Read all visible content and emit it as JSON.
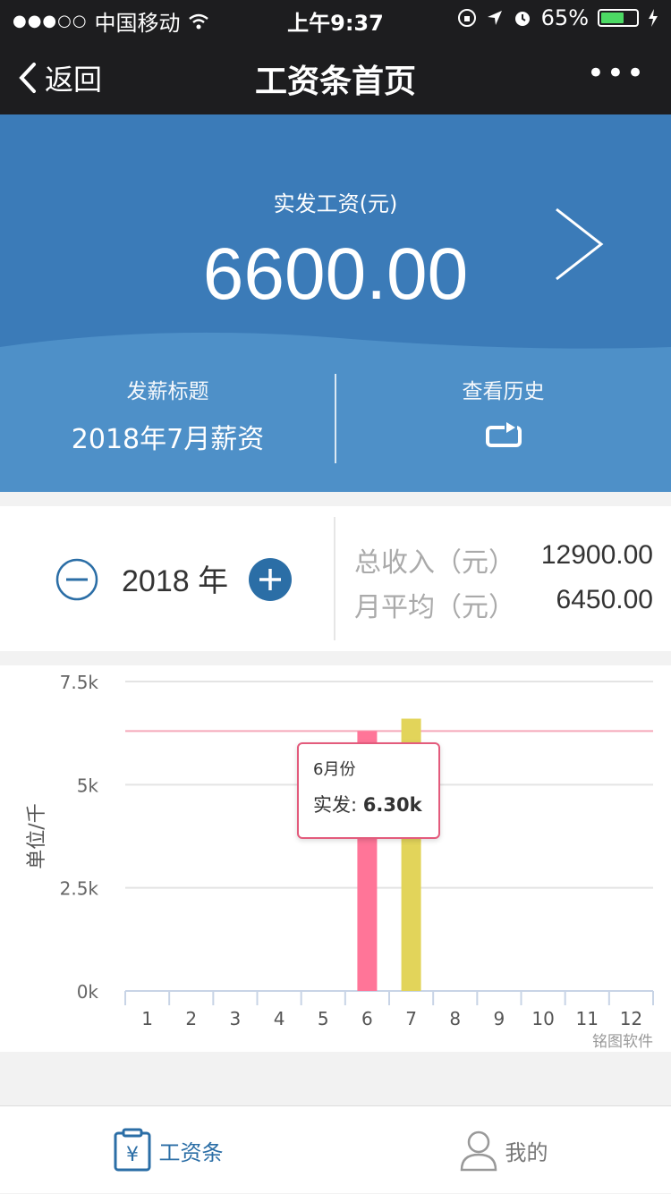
{
  "status_bar": {
    "signal_dots": "●●●○○",
    "carrier": "中国移动",
    "time": "上午9:37",
    "battery": "65%",
    "battery_level": 0.65
  },
  "nav": {
    "back_label": "返回",
    "title": "工资条首页",
    "more_label": "•••"
  },
  "hero": {
    "label": "实发工资(元)",
    "amount": "6600.00",
    "title_key": "发薪标题",
    "title_value": "2018年7月薪资",
    "history_label": "查看历史"
  },
  "year_panel": {
    "year_label": "2018 年",
    "total_key": "总收入（元）",
    "total_value": "12900.00",
    "avg_key": "月平均（元）",
    "avg_value": "6450.00"
  },
  "chart": {
    "tooltip_month": "6月份",
    "tooltip_key": "实发:",
    "tooltip_value": "6.30k",
    "watermark": "铭图软件"
  },
  "chart_data": {
    "type": "bar",
    "ylabel": "单位/千",
    "y_ticks": [
      "0k",
      "2.5k",
      "5k",
      "7.5k"
    ],
    "ylim": [
      0,
      7500
    ],
    "categories": [
      "1",
      "2",
      "3",
      "4",
      "5",
      "6",
      "7",
      "8",
      "9",
      "10",
      "11",
      "12"
    ],
    "values": [
      0,
      0,
      0,
      0,
      0,
      6300,
      6600,
      0,
      0,
      0,
      0,
      0
    ],
    "reference_line": 6300,
    "bar_colors": {
      "6": "#ff7598",
      "7": "#e2d45a"
    },
    "grid": true
  },
  "tabbar": {
    "tab1_label": "工资条",
    "tab2_label": "我的"
  },
  "colors": {
    "nav_bg": "#1d1d1f",
    "hero_bg": "#3b7bb8",
    "hero_wave": "#4e90c8",
    "accent": "#2b6ea6"
  }
}
